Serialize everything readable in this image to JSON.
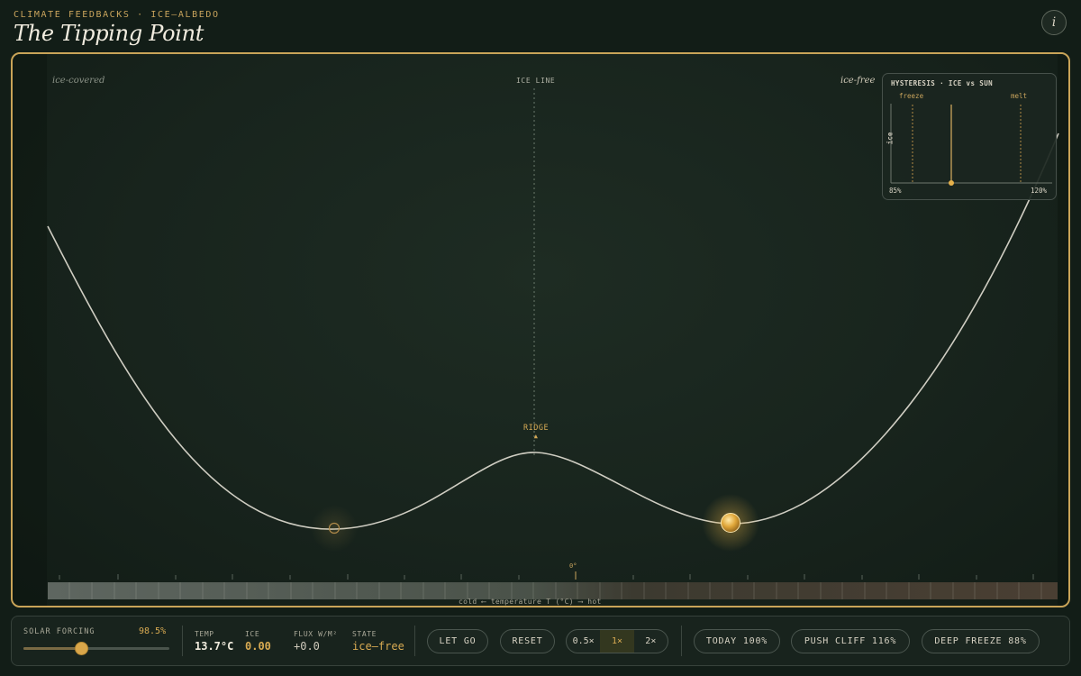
{
  "header": {
    "kicker": "CLIMATE FEEDBACKS · ICE–ALBEDO",
    "title": "The Tipping Point",
    "info_icon": "i"
  },
  "stage": {
    "label_left": "ice-covered",
    "label_right": "ice-free",
    "ice_line_label": "ICE LINE",
    "ridge_label": "RIDGE",
    "ridge_arrow": "▲",
    "zero_label": "0°",
    "axis_caption": "cold ⟵ temperature T (°C) ⟶ hot"
  },
  "inset": {
    "title": "HYSTERESIS · ICE vs SUN",
    "freeze_label": "freeze",
    "melt_label": "melt",
    "y_label": "ice",
    "x_min_label": "85%",
    "x_max_label": "120%"
  },
  "controls": {
    "solar_label": "SOLAR FORCING",
    "solar_value": "98.5%",
    "solar_fraction": 0.4,
    "temp_key": "TEMP",
    "temp_value": "13.7°C",
    "ice_key": "ICE",
    "ice_value": "0.00",
    "flux_key": "FLUX W/M²",
    "flux_value": "+0.0",
    "state_key": "STATE",
    "state_value": "ice–free",
    "let_go": "LET GO",
    "reset": "RESET",
    "speeds": [
      "0.5×",
      "1×",
      "2×"
    ],
    "active_speed": "1×",
    "preset_today": "TODAY 100%",
    "preset_push": "PUSH CLIFF 116%",
    "preset_freeze": "DEEP FREEZE 88%"
  },
  "colors": {
    "accent": "#c9a458",
    "background": "#121d17",
    "curve": "#cfcdc2",
    "ball": "#e0a73a"
  }
}
